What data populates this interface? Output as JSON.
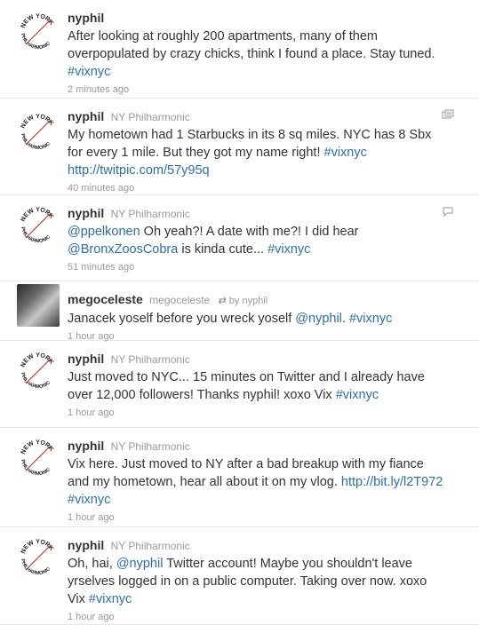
{
  "tweets": [
    {
      "avatar": "ny-philharmonic-logo",
      "screen_name": "nyphil",
      "full_name": "",
      "lines": [
        [
          {
            "t": "After looking at roughly 200 apartments, many of them"
          }
        ],
        [
          {
            "t": "overpopulated by crazy chicks, think I found a place. Stay tuned."
          }
        ],
        [
          {
            "t": "#vixnyc",
            "link": true
          }
        ]
      ],
      "time": "2 minutes ago"
    },
    {
      "avatar": "ny-philharmonic-logo",
      "screen_name": "nyphil",
      "full_name": "NY Philharmonic",
      "icon": "gallery-icon",
      "lines": [
        [
          {
            "t": "My hometown had 1 Starbucks in its 8 sq miles. NYC has 8 Sbx"
          }
        ],
        [
          {
            "t": "for every 1 mile. But they got my name right! "
          },
          {
            "t": "#vixnyc",
            "link": true
          }
        ],
        [
          {
            "t": "http://twitpic.com/57y95q",
            "link": true
          }
        ]
      ],
      "time": "40 minutes ago"
    },
    {
      "avatar": "ny-philharmonic-logo",
      "screen_name": "nyphil",
      "full_name": "NY Philharmonic",
      "icon": "conversation-icon",
      "lines": [
        [
          {
            "t": "@ppelkonen",
            "link": true
          },
          {
            "t": " Oh yeah?! A date with me?! I did hear"
          }
        ],
        [
          {
            "t": "@BronxZoosCobra",
            "link": true
          },
          {
            "t": " is kinda cute... "
          },
          {
            "t": "#vixnyc",
            "link": true
          }
        ]
      ],
      "time": "51 minutes ago"
    },
    {
      "avatar": "user-photo",
      "screen_name": "megoceleste",
      "full_name": "megoceleste",
      "retweet": {
        "icon": "retweet-icon",
        "label": "by nyphil"
      },
      "lines": [
        [
          {
            "t": "Janacek yoself before you wreck yoself "
          },
          {
            "t": "@nyphil",
            "link": true
          },
          {
            "t": ". "
          },
          {
            "t": "#vixnyc",
            "link": true
          }
        ]
      ],
      "time": "1 hour ago"
    },
    {
      "avatar": "ny-philharmonic-logo",
      "screen_name": "nyphil",
      "full_name": "NY Philharmonic",
      "lines": [
        [
          {
            "t": "Just moved to NYC... 15 minutes on Twitter and I already have"
          }
        ],
        [
          {
            "t": "over 12,000 followers! Thanks nyphil! xoxo Vix "
          },
          {
            "t": "#vixnyc",
            "link": true
          }
        ]
      ],
      "time": "1 hour ago"
    },
    {
      "avatar": "ny-philharmonic-logo",
      "screen_name": "nyphil",
      "full_name": "NY Philharmonic",
      "lines": [
        [
          {
            "t": "Vix here. Just moved to NY after a bad breakup with my fiance"
          }
        ],
        [
          {
            "t": "and my hometown, hear all about it on my vlog. "
          },
          {
            "t": "http://bit.ly/l2T972",
            "link": true
          }
        ],
        [
          {
            "t": "#vixnyc",
            "link": true
          }
        ]
      ],
      "time": "1 hour ago"
    },
    {
      "avatar": "ny-philharmonic-logo",
      "screen_name": "nyphil",
      "full_name": "NY Philharmonic",
      "lines": [
        [
          {
            "t": "Oh, hai, "
          },
          {
            "t": "@nyphil",
            "link": true
          },
          {
            "t": " Twitter account! Maybe you shouldn't leave"
          }
        ],
        [
          {
            "t": "yrselves logged in on a public computer. Taking over now. xoxo"
          }
        ],
        [
          {
            "t": "Vix "
          },
          {
            "t": "#vixnyc",
            "link": true
          }
        ]
      ],
      "time": "1 hour ago"
    }
  ],
  "logo": {
    "top_text": "NEW YORK",
    "bottom_text": "PHILHARMONIC"
  },
  "colors": {
    "link": "#2a6eb0",
    "text": "#333333",
    "meta": "#999999",
    "divider": "#e8e8e8"
  }
}
